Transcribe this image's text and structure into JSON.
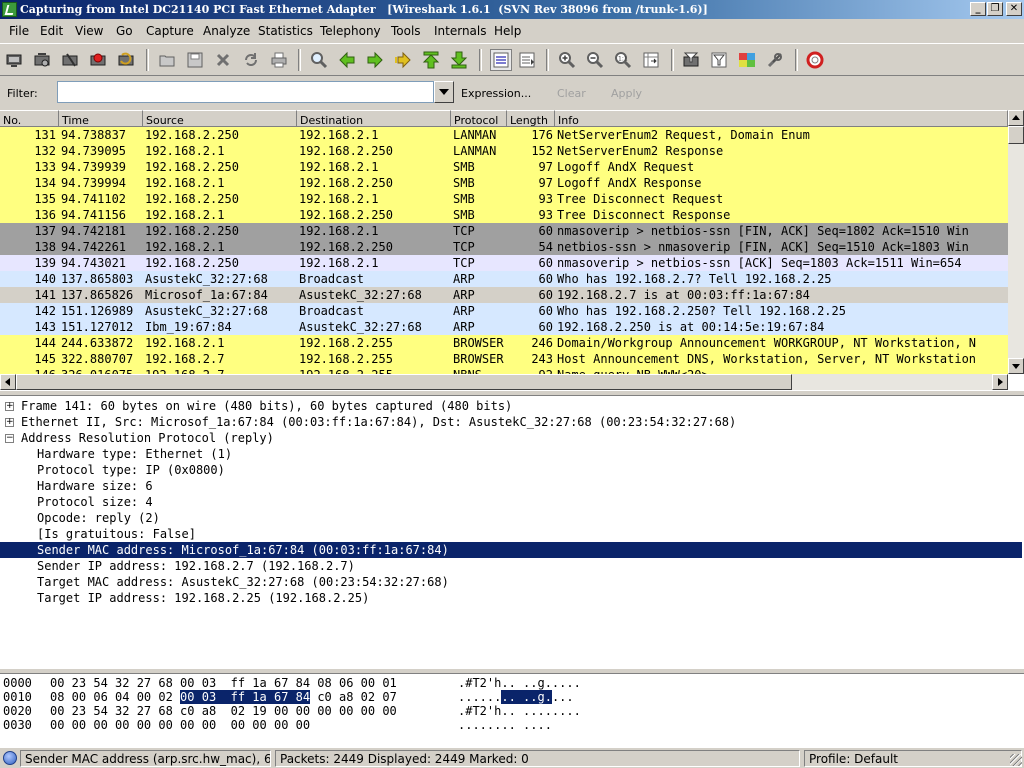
{
  "window": {
    "title": "Capturing from Intel DC21140 PCI Fast Ethernet Adapter   [Wireshark 1.6.1  (SVN Rev 38096 from /trunk-1.6)]",
    "minimize_glyph": "_",
    "maximize_glyph": "❐",
    "close_glyph": "✕"
  },
  "menu": [
    "File",
    "Edit",
    "View",
    "Go",
    "Capture",
    "Analyze",
    "Statistics",
    "Telephony",
    "Tools",
    "Internals",
    "Help"
  ],
  "toolbar": {
    "icons": [
      "interface-list-icon",
      "capture-options-icon",
      "start-capture-icon",
      "stop-capture-icon",
      "restart-capture-icon",
      "open-file-icon",
      "save-file-icon",
      "close-file-icon",
      "reload-icon",
      "print-icon",
      "find-packet-icon",
      "go-back-icon",
      "go-forward-icon",
      "go-to-packet-icon",
      "go-to-first-icon",
      "go-to-last-icon",
      "colorize-icon",
      "auto-scroll-icon",
      "zoom-in-icon",
      "zoom-out-icon",
      "normal-size-icon",
      "resize-columns-icon",
      "capture-filters-icon",
      "display-filters-icon",
      "coloring-rules-icon",
      "preferences-icon",
      "help-icon"
    ]
  },
  "filter": {
    "label": "Filter:",
    "value": "",
    "expression_label": "Expression...",
    "clear_label": "Clear",
    "apply_label": "Apply"
  },
  "packet_list": {
    "columns": [
      "No.",
      "Time",
      "Source",
      "Destination",
      "Protocol",
      "Length",
      "Info"
    ],
    "rows": [
      {
        "no": "131",
        "time": "94.738837",
        "src": "192.168.2.250",
        "dst": "192.168.2.1",
        "proto": "LANMAN",
        "len": "176",
        "info": "NetServerEnum2 Request, Domain Enum",
        "bg": "#ffff80",
        "fg": "#000000"
      },
      {
        "no": "132",
        "time": "94.739095",
        "src": "192.168.2.1",
        "dst": "192.168.2.250",
        "proto": "LANMAN",
        "len": "152",
        "info": "NetServerEnum2 Response",
        "bg": "#ffff80",
        "fg": "#000000"
      },
      {
        "no": "133",
        "time": "94.739939",
        "src": "192.168.2.250",
        "dst": "192.168.2.1",
        "proto": "SMB",
        "len": "97",
        "info": "Logoff AndX Request",
        "bg": "#ffff80",
        "fg": "#000000"
      },
      {
        "no": "134",
        "time": "94.739994",
        "src": "192.168.2.1",
        "dst": "192.168.2.250",
        "proto": "SMB",
        "len": "97",
        "info": "Logoff AndX Response",
        "bg": "#ffff80",
        "fg": "#000000"
      },
      {
        "no": "135",
        "time": "94.741102",
        "src": "192.168.2.250",
        "dst": "192.168.2.1",
        "proto": "SMB",
        "len": "93",
        "info": "Tree Disconnect Request",
        "bg": "#ffff80",
        "fg": "#000000"
      },
      {
        "no": "136",
        "time": "94.741156",
        "src": "192.168.2.1",
        "dst": "192.168.2.250",
        "proto": "SMB",
        "len": "93",
        "info": "Tree Disconnect Response",
        "bg": "#ffff80",
        "fg": "#000000"
      },
      {
        "no": "137",
        "time": "94.742181",
        "src": "192.168.2.250",
        "dst": "192.168.2.1",
        "proto": "TCP",
        "len": "60",
        "info": "nmasoverip > netbios-ssn [FIN, ACK] Seq=1802 Ack=1510 Win",
        "bg": "#a0a0a0",
        "fg": "#000000"
      },
      {
        "no": "138",
        "time": "94.742261",
        "src": "192.168.2.1",
        "dst": "192.168.2.250",
        "proto": "TCP",
        "len": "54",
        "info": "netbios-ssn > nmasoverip [FIN, ACK] Seq=1510 Ack=1803 Win",
        "bg": "#a0a0a0",
        "fg": "#000000"
      },
      {
        "no": "139",
        "time": "94.743021",
        "src": "192.168.2.250",
        "dst": "192.168.2.1",
        "proto": "TCP",
        "len": "60",
        "info": "nmasoverip > netbios-ssn [ACK] Seq=1803 Ack=1511 Win=654",
        "bg": "#e7e6ff",
        "fg": "#000000"
      },
      {
        "no": "140",
        "time": "137.865803",
        "src": "AsustekC_32:27:68",
        "dst": "Broadcast",
        "proto": "ARP",
        "len": "60",
        "info": "Who has 192.168.2.7?  Tell 192.168.2.25",
        "bg": "#d6e8ff",
        "fg": "#000000"
      },
      {
        "no": "141",
        "time": "137.865826",
        "src": "Microsof_1a:67:84",
        "dst": "AsustekC_32:27:68",
        "proto": "ARP",
        "len": "60",
        "info": "192.168.2.7 is at 00:03:ff:1a:67:84",
        "bg": "#d4d0c8",
        "fg": "#000000"
      },
      {
        "no": "142",
        "time": "151.126989",
        "src": "AsustekC_32:27:68",
        "dst": "Broadcast",
        "proto": "ARP",
        "len": "60",
        "info": "Who has 192.168.2.250?  Tell 192.168.2.25",
        "bg": "#d6e8ff",
        "fg": "#000000"
      },
      {
        "no": "143",
        "time": "151.127012",
        "src": "Ibm_19:67:84",
        "dst": "AsustekC_32:27:68",
        "proto": "ARP",
        "len": "60",
        "info": "192.168.2.250 is at 00:14:5e:19:67:84",
        "bg": "#d6e8ff",
        "fg": "#000000"
      },
      {
        "no": "144",
        "time": "244.633872",
        "src": "192.168.2.1",
        "dst": "192.168.2.255",
        "proto": "BROWSER",
        "len": "246",
        "info": "Domain/Workgroup Announcement WORKGROUP, NT Workstation, N",
        "bg": "#ffff80",
        "fg": "#000000"
      },
      {
        "no": "145",
        "time": "322.880707",
        "src": "192.168.2.7",
        "dst": "192.168.2.255",
        "proto": "BROWSER",
        "len": "243",
        "info": "Host Announcement DNS, Workstation, Server, NT Workstation",
        "bg": "#ffff80",
        "fg": "#000000"
      },
      {
        "no": "146",
        "time": "326.016075",
        "src": "192.168.2.7",
        "dst": "192.168.2.255",
        "proto": "NBNS",
        "len": "92",
        "info": "Name query NB WWW<20>",
        "bg": "#ffff80",
        "fg": "#000000"
      }
    ]
  },
  "details": {
    "rows": [
      {
        "indent": 0,
        "expander": "+",
        "text": "Frame 141: 60 bytes on wire (480 bits), 60 bytes captured (480 bits)",
        "selected": false
      },
      {
        "indent": 0,
        "expander": "+",
        "text": "Ethernet II, Src: Microsof_1a:67:84 (00:03:ff:1a:67:84), Dst: AsustekC_32:27:68 (00:23:54:32:27:68)",
        "selected": false
      },
      {
        "indent": 0,
        "expander": "−",
        "text": "Address Resolution Protocol (reply)",
        "selected": false
      },
      {
        "indent": 1,
        "expander": "",
        "text": "Hardware type: Ethernet (1)",
        "selected": false
      },
      {
        "indent": 1,
        "expander": "",
        "text": "Protocol type: IP (0x0800)",
        "selected": false
      },
      {
        "indent": 1,
        "expander": "",
        "text": "Hardware size: 6",
        "selected": false
      },
      {
        "indent": 1,
        "expander": "",
        "text": "Protocol size: 4",
        "selected": false
      },
      {
        "indent": 1,
        "expander": "",
        "text": "Opcode: reply (2)",
        "selected": false
      },
      {
        "indent": 1,
        "expander": "",
        "text": "[Is gratuitous: False]",
        "selected": false
      },
      {
        "indent": 1,
        "expander": "",
        "text": "Sender MAC address: Microsof_1a:67:84 (00:03:ff:1a:67:84)",
        "selected": true
      },
      {
        "indent": 1,
        "expander": "",
        "text": "Sender IP address: 192.168.2.7 (192.168.2.7)",
        "selected": false
      },
      {
        "indent": 1,
        "expander": "",
        "text": "Target MAC address: AsustekC_32:27:68 (00:23:54:32:27:68)",
        "selected": false
      },
      {
        "indent": 1,
        "expander": "",
        "text": "Target IP address: 192.168.2.25 (192.168.2.25)",
        "selected": false
      }
    ]
  },
  "bytes": {
    "rows": [
      {
        "offset": "0000",
        "hex_pre": "00 23 54 32 27 68 00 03  ff 1a 67 84 08 06 00 01",
        "hex_hl": "",
        "hex_post": "",
        "asc_pre": ".#T2'h.. ..g.....",
        "asc_hl": "",
        "asc_post": ""
      },
      {
        "offset": "0010",
        "hex_pre": "08 00 06 04 00 02 ",
        "hex_hl": "00 03  ff 1a 67 84",
        "hex_post": " c0 a8 02 07",
        "asc_pre": "......",
        "asc_hl": ".. ..g.",
        "asc_post": "..."
      },
      {
        "offset": "0020",
        "hex_pre": "00 23 54 32 27 68 c0 a8  02 19 00 00 00 00 00 00",
        "hex_hl": "",
        "hex_post": "",
        "asc_pre": ".#T2'h.. ........",
        "asc_hl": "",
        "asc_post": ""
      },
      {
        "offset": "0030",
        "hex_pre": "00 00 00 00 00 00 00 00  00 00 00 00",
        "hex_hl": "",
        "hex_post": "",
        "asc_pre": "........ ....",
        "asc_hl": "",
        "asc_post": ""
      }
    ]
  },
  "status": {
    "field": "Sender MAC address (arp.src.hw_mac), 6...",
    "packets": "Packets: 2449 Displayed: 2449 Marked: 0",
    "profile": "Profile: Default"
  }
}
